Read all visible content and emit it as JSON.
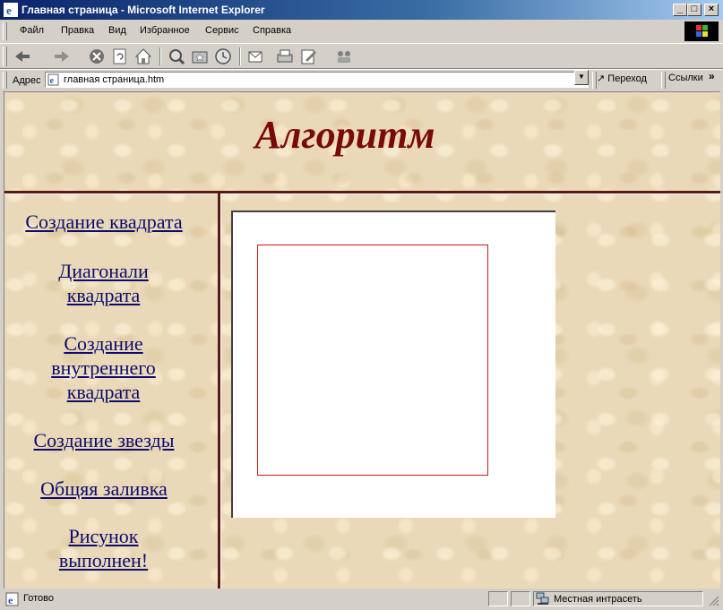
{
  "window": {
    "title": "Главная страница - Microsoft Internet Explorer",
    "buttons": [
      "_",
      "□",
      "×"
    ]
  },
  "menu": [
    "Файл",
    "Правка",
    "Вид",
    "Избранное",
    "Сервис",
    "Справка"
  ],
  "toolbar": {
    "icons": [
      "back-icon",
      "forward-icon",
      "stop-icon",
      "refresh-icon",
      "home-icon",
      "search-icon",
      "favorites-icon",
      "history-icon",
      "mail-icon",
      "print-icon",
      "edit-icon",
      "discuss-icon"
    ]
  },
  "address": {
    "label": "Адрес",
    "value": "главная страница.htm",
    "go": "Переход",
    "links": "Ссылки",
    "more": "»"
  },
  "page": {
    "title": "Алгоритм",
    "nav": [
      "Создание квадрата",
      "Диагонали квадрата",
      "Создание внутреннего квадрата",
      "Создание звезды",
      "Общяя заливка",
      "Рисунок выполнен!"
    ],
    "colors": {
      "title": "#7a0a0a",
      "link": "#0c0c6e",
      "square_border": "#d01818",
      "separator": "#5a1818"
    }
  },
  "status": {
    "text": "Готово",
    "zone": "Местная интрасеть"
  }
}
